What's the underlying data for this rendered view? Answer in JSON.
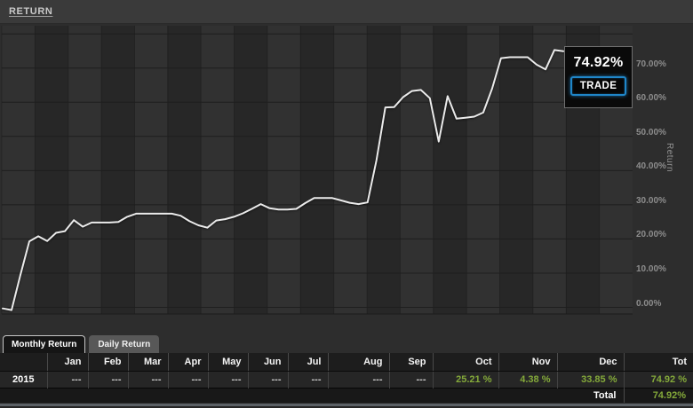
{
  "header": {
    "title": "RETURN"
  },
  "chart": {
    "y_axis": {
      "title": "Return",
      "tick_labels": [
        "0.00%",
        "10.00%",
        "20.00%",
        "30.00%",
        "40.00%",
        "50.00%",
        "60.00%",
        "70.00%"
      ]
    },
    "tooltip": {
      "value": "74.92%",
      "button_label": "TRADE"
    }
  },
  "chart_data": {
    "type": "line",
    "title": "RETURN",
    "ylabel": "Return",
    "yticks": [
      0,
      10,
      20,
      30,
      40,
      50,
      60,
      70
    ],
    "ylim": [
      -3,
      82
    ],
    "grid": true,
    "legend_position": "none",
    "last_value": 74.92,
    "series": [
      {
        "name": "Return",
        "values": [
          -0.3,
          -0.8,
          9.5,
          19.3,
          20.8,
          19.4,
          21.8,
          22.3,
          25.5,
          23.6,
          24.8,
          24.8,
          24.8,
          25.0,
          26.5,
          27.4,
          27.4,
          27.4,
          27.4,
          27.4,
          26.8,
          25.2,
          24.0,
          23.3,
          25.4,
          25.8,
          26.5,
          27.5,
          28.8,
          30.2,
          29.0,
          28.6,
          28.6,
          28.8,
          30.5,
          32.0,
          32.0,
          32.0,
          31.3,
          30.6,
          30.2,
          30.7,
          43.0,
          58.5,
          58.6,
          61.5,
          63.3,
          63.6,
          61.2,
          48.5,
          61.8,
          55.2,
          55.5,
          55.8,
          57.0,
          64.0,
          72.9,
          73.2,
          73.2,
          73.2,
          71.0,
          69.6,
          75.3,
          74.92
        ]
      }
    ]
  },
  "tabs": [
    {
      "label": "Monthly Return",
      "active": true
    },
    {
      "label": "Daily Return",
      "active": false
    }
  ],
  "table": {
    "columns": [
      "",
      "Jan",
      "Feb",
      "Mar",
      "Apr",
      "May",
      "Jun",
      "Jul",
      "Aug",
      "Sep",
      "Oct",
      "Nov",
      "Dec",
      "Tot"
    ],
    "rows": [
      {
        "year": "2015",
        "values": [
          "---",
          "---",
          "---",
          "---",
          "---",
          "---",
          "---",
          "---",
          "---",
          "25.21 %",
          "4.38 %",
          "33.85 %",
          "74.92 %"
        ]
      }
    ],
    "footer": {
      "label": "Total",
      "value": "74.92%"
    }
  },
  "colors": {
    "positive_value": "#84a93a",
    "accent_blue": "#1f86c9",
    "line": "#ebebeb",
    "band_light": "#313131",
    "band_dark": "#272727"
  }
}
